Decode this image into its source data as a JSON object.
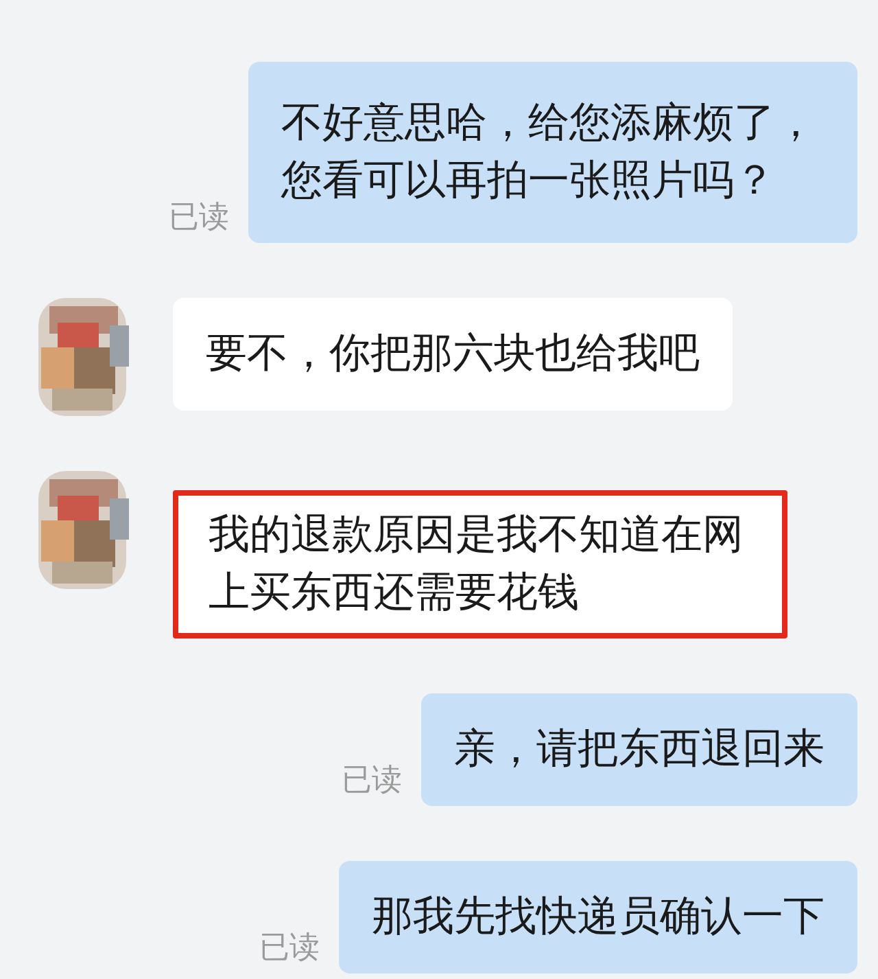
{
  "messages": [
    {
      "kind": "outgoing",
      "text": "不好意思哈，给您添麻烦了，您看可以再拍一张照片吗？",
      "read_label": "已读",
      "highlighted": false
    },
    {
      "kind": "incoming",
      "text": "要不，你把那六块也给我吧",
      "highlighted": false
    },
    {
      "kind": "incoming",
      "text": "我的退款原因是我不知道在网上买东西还需要花钱",
      "highlighted": true
    },
    {
      "kind": "outgoing",
      "text": "亲，请把东西退回来",
      "read_label": "已读",
      "highlighted": false
    },
    {
      "kind": "outgoing",
      "text": "那我先找快递员确认一下",
      "read_label": "已读",
      "highlighted": false
    }
  ]
}
